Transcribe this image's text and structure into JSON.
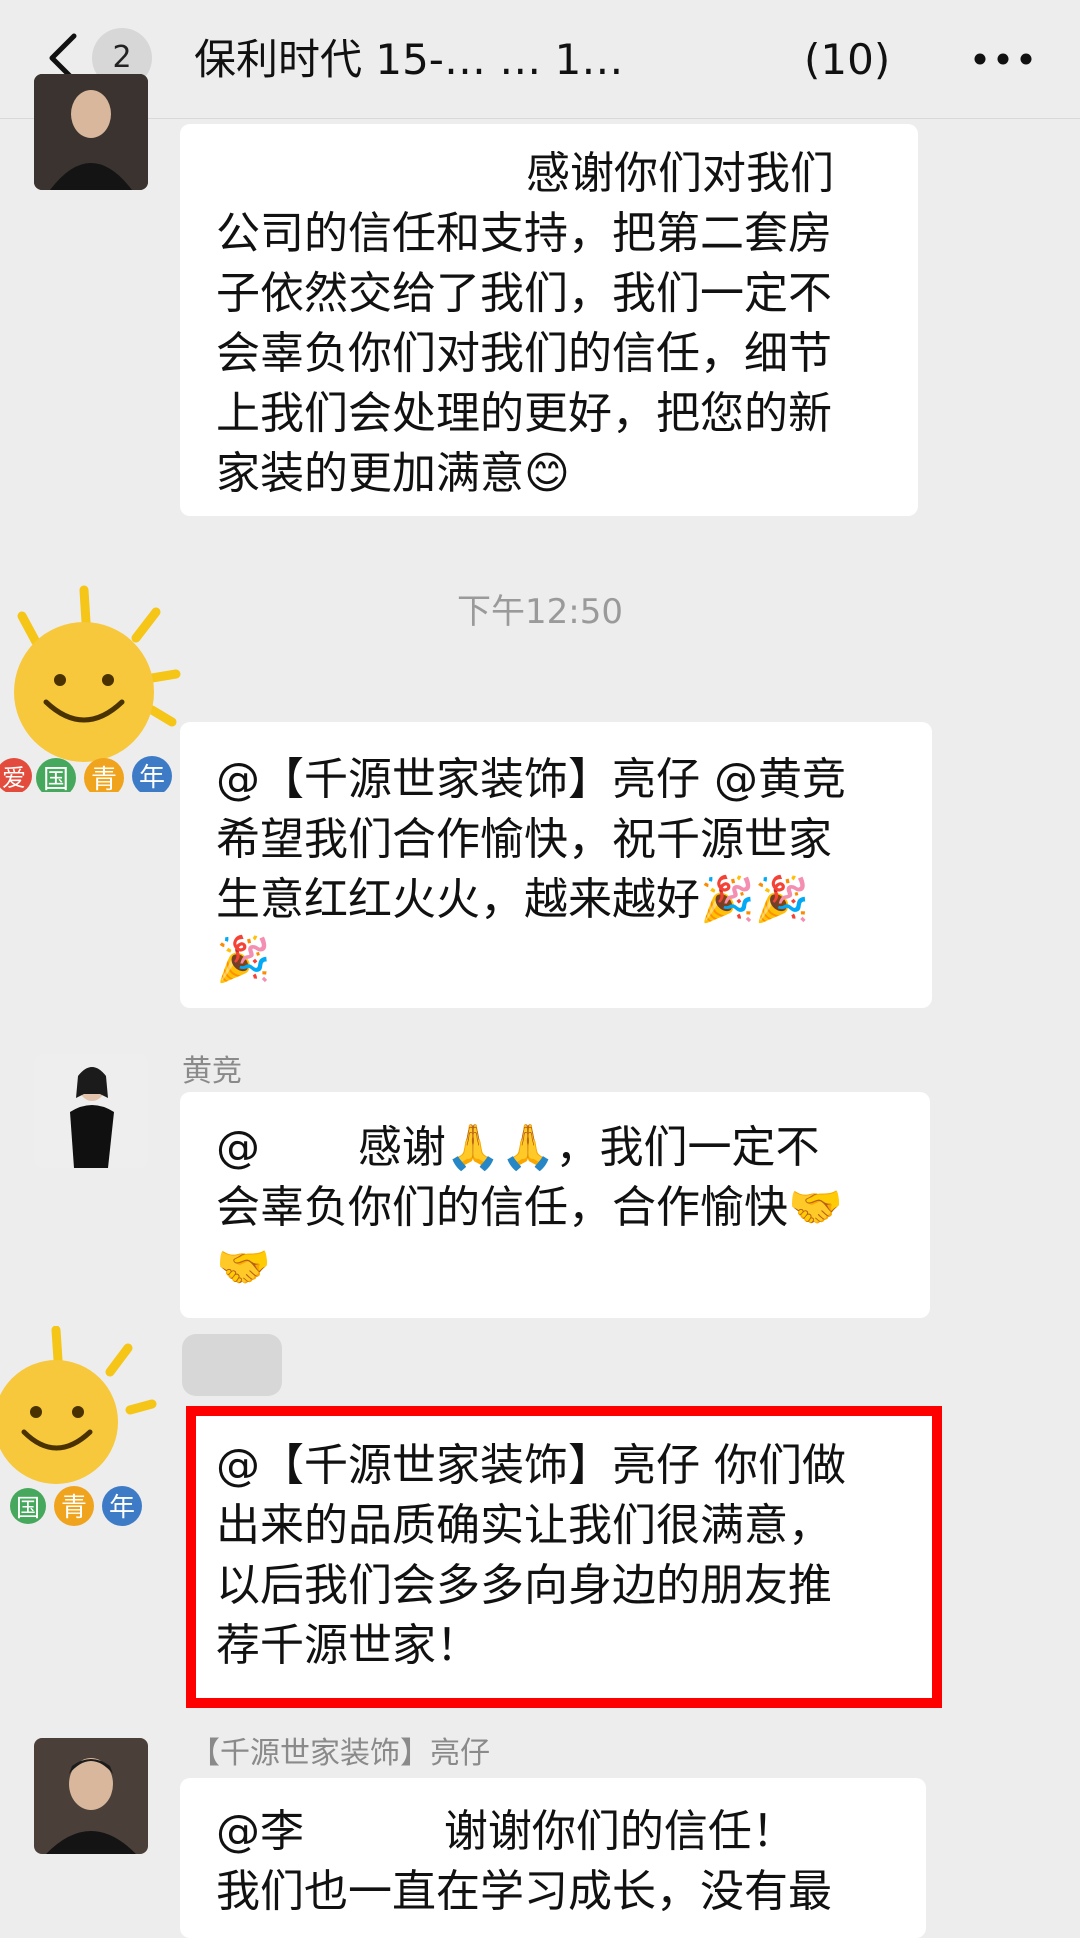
{
  "header": {
    "unread_count": "2",
    "title": "保利时代 15-… … 1…",
    "member_count": "(10)"
  },
  "messages": [
    {
      "text": "感谢你们对我们\n公司的信任和支持，把第二套房\n子依然交给了我们，我们一定不\n会辜负你们对我们的信任，细节\n上我们会处理的更好，把您的新\n家装的更加满意😊"
    },
    {
      "timestamp": "下午12:50"
    },
    {
      "text": "@【千源世家装饰】亮仔 @黄竞\n希望我们合作愉快，祝千源世家\n生意红红火火，越来越好🎉🎉\n🎉"
    },
    {
      "sender": "黄竞",
      "text": "@       感谢🙏🙏，我们一定不\n会辜负你们的信任，合作愉快🤝\n🤝"
    },
    {
      "text": "@【千源世家装饰】亮仔 你们做\n出来的品质确实让我们很满意，\n以后我们会多多向身边的朋友推\n荐千源世家！"
    },
    {
      "sender": "【千源世家装饰】亮仔",
      "text": "@李          谢谢你们的信任！\n我们也一直在学习成长，没有最"
    }
  ],
  "badge_chars": [
    "爱",
    "国",
    "青",
    "年"
  ],
  "colors": {
    "background": "#ededed",
    "bubble": "#ffffff",
    "highlight": "#ff0000",
    "timestamp": "#9a9a9a"
  }
}
